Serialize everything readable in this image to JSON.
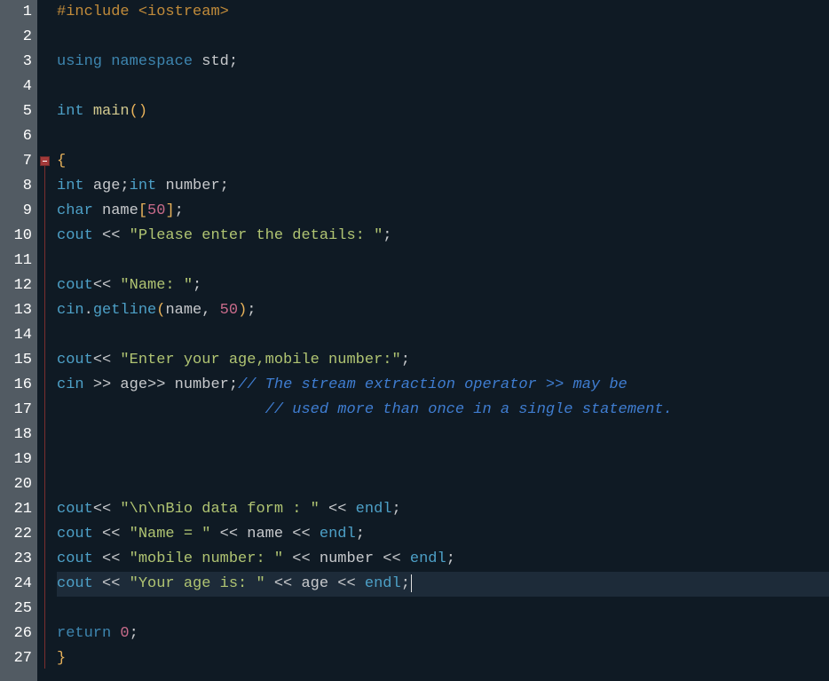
{
  "lineCount": 27,
  "foldMarkerLine": 7,
  "foldStartLine": 7,
  "foldEndLine": 27,
  "highlightLine": 24,
  "code": {
    "l1": {
      "pp": "#include ",
      "ang": "<iostream>"
    },
    "l3": {
      "kw1": "using ",
      "kw2": "namespace ",
      "id": "std",
      "semi": ";"
    },
    "l5": {
      "type": "int ",
      "fn": "main",
      "p": "()"
    },
    "l7": {
      "br": "{"
    },
    "l8": {
      "type1": "int ",
      "id1": "age",
      "semi1": ";",
      "type2": "int ",
      "id2": "number",
      "semi2": ";"
    },
    "l9": {
      "type": "char ",
      "id": "name",
      "lb": "[",
      "num": "50",
      "rb": "]",
      "semi": ";"
    },
    "l10": {
      "cout": "cout ",
      "op": "<< ",
      "str": "\"Please enter the details: \"",
      "semi": ";"
    },
    "l12": {
      "cout": "cout",
      "op": "<< ",
      "str": "\"Name: \"",
      "semi": ";"
    },
    "l13": {
      "cin": "cin",
      "dot": ".",
      "gl": "getline",
      "lp": "(",
      "id": "name",
      "comma": ", ",
      "num": "50",
      "rp": ")",
      "semi": ";"
    },
    "l15": {
      "cout": "cout",
      "op": "<< ",
      "str": "\"Enter your age,mobile number:\"",
      "semi": ";"
    },
    "l16": {
      "cin": "cin ",
      "op1": ">> ",
      "id1": "age",
      "op2": ">> ",
      "id2": "number",
      "semi": ";",
      "cmt": "// The stream extraction operator >> may be"
    },
    "l17": {
      "cmt": "// used more than once in a single statement."
    },
    "l21": {
      "cout": "cout",
      "op1": "<< ",
      "str": "\"\\n\\nBio data form : \"",
      "op2": " << ",
      "endl": "endl",
      "semi": ";"
    },
    "l22": {
      "cout": "cout ",
      "op1": "<< ",
      "str": "\"Name = \"",
      "op2": " << ",
      "id": "name",
      "op3": " << ",
      "endl": "endl",
      "semi": ";"
    },
    "l23": {
      "cout": "cout ",
      "op1": "<< ",
      "str": "\"mobile number: \"",
      "op2": " << ",
      "id": "number",
      "op3": " << ",
      "endl": "endl",
      "semi": ";"
    },
    "l24": {
      "cout": "cout ",
      "op1": "<< ",
      "str": "\"Your age is: \"",
      "op2": " << ",
      "id": "age",
      "op3": " << ",
      "endl": "endl",
      "semi": ";"
    },
    "l26": {
      "kw": "return ",
      "num": "0",
      "semi": ";"
    },
    "l27": {
      "br": "}"
    }
  }
}
